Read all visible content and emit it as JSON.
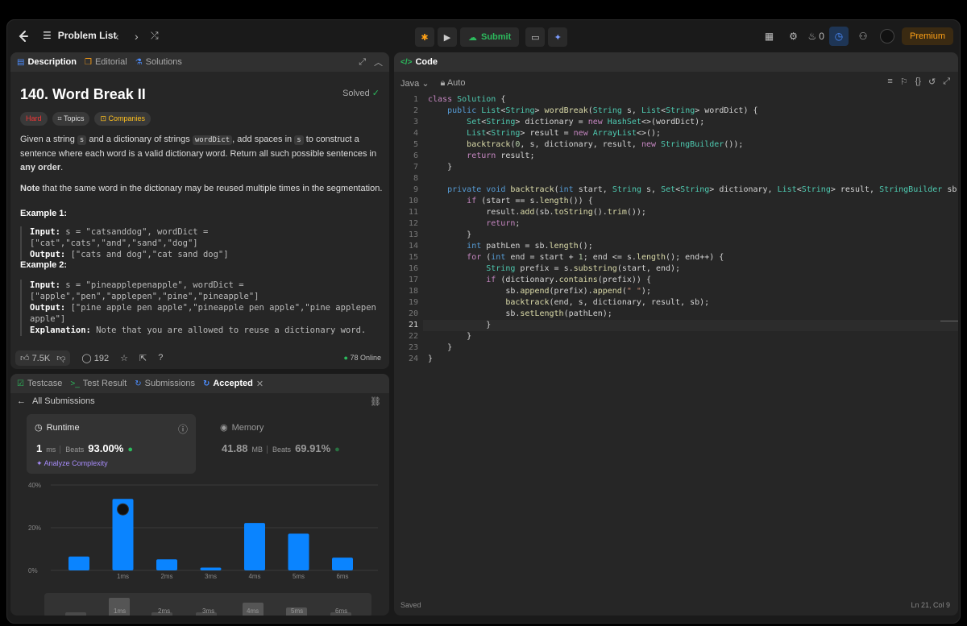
{
  "topbar": {
    "problem_list": "Problem List",
    "submit": "Submit",
    "counter": "0",
    "premium": "Premium"
  },
  "left_tabs": {
    "description": "Description",
    "editorial": "Editorial",
    "solutions": "Solutions"
  },
  "problem": {
    "title": "140. Word Break II",
    "solved": "Solved",
    "difficulty": "Hard",
    "topics": "Topics",
    "companies": "Companies",
    "p1a": "Given a string ",
    "p1s": "s",
    "p1b": " and a dictionary of strings ",
    "p1d": "wordDict",
    "p1c": ", add spaces in ",
    "p1s2": "s",
    "p1e": " to construct a sentence where each word is a valid dictionary word. Return all such possible sentences in ",
    "p1bold": "any order",
    "p1end": ".",
    "p2bold": "Note",
    "p2": " that the same word in the dictionary may be reused multiple times in the segmentation.",
    "ex1_title": "Example 1:",
    "ex1_input_label": "Input:",
    "ex1_input": " s = \"catsanddog\", wordDict = [\"cat\",\"cats\",\"and\",\"sand\",\"dog\"]",
    "ex1_output_label": "Output:",
    "ex1_output": " [\"cats and dog\",\"cat sand dog\"]",
    "ex2_title": "Example 2:",
    "ex2_input_label": "Input:",
    "ex2_input": " s = \"pineapplepenapple\", wordDict = [\"apple\",\"pen\",\"applepen\",\"pine\",\"pineapple\"]",
    "ex2_output_label": "Output:",
    "ex2_output": " [\"pine apple pen apple\",\"pineapple pen apple\",\"pine applepen apple\"]",
    "ex2_expl_label": "Explanation:",
    "ex2_expl": " Note that you are allowed to reuse a dictionary word."
  },
  "footer": {
    "likes": "7.5K",
    "comments": "192",
    "online": "78 Online"
  },
  "bottom_tabs": {
    "testcase": "Testcase",
    "test_result": "Test Result",
    "submissions": "Submissions",
    "accepted": "Accepted"
  },
  "submission": {
    "all_submissions": "All Submissions",
    "runtime_label": "Runtime",
    "runtime_value": "1",
    "runtime_unit": "ms",
    "runtime_beats_label": "Beats",
    "runtime_beats": "93.00%",
    "analyze": "Analyze Complexity",
    "memory_label": "Memory",
    "memory_value": "41.88",
    "memory_unit": "MB",
    "memory_beats_label": "Beats",
    "memory_beats": "69.91%"
  },
  "chart_data": {
    "type": "bar",
    "y_ticks": [
      "40%",
      "20%",
      "0%"
    ],
    "ylim": [
      0,
      40
    ],
    "x_labels": [
      "1ms",
      "2ms",
      "3ms",
      "4ms",
      "5ms",
      "6ms"
    ],
    "values": [
      6.5,
      33.5,
      5.2,
      1.3,
      22.2,
      17.2,
      6.0
    ],
    "highlight_index": 1
  },
  "mini_labels": [
    "1ms",
    "2ms",
    "3ms",
    "4ms",
    "5ms",
    "6ms"
  ],
  "code_panel": {
    "title": "Code",
    "language": "Java",
    "mode": "Auto",
    "status": "Saved",
    "cursor": "Ln 21, Col 9"
  },
  "colors": {
    "accent": "#ffa116",
    "accepted": "#2cbb5d",
    "bar": "#0a84ff",
    "hard": "#f63737"
  }
}
